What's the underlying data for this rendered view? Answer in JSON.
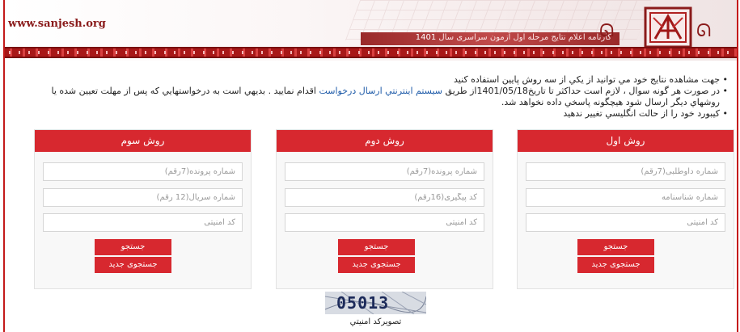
{
  "header": {
    "site_url": "www.sanjesh.org",
    "title_prefix": "کارنامه اعلام نتايج مرحله اول آزمون سراسری سال",
    "title_year": "1401"
  },
  "instructions": {
    "line1": "جهت مشاهده نتايج خود مي توانيد از يكي از سه روش پايين استفاده كنيد",
    "line2_start": "در صورت هر گونه سوال ، لازم است حداكثر تا تاريخ1401/05/18از طريق ",
    "line2_link": "سيستم اينترنتي ارسال درخواست",
    "line2_end": " اقدام نماييد . بديهي است به درخواستهايي كه پس از مهلت تعيين شده يا روشهاي ديگر ارسال شود هيچگونه پاسخي داده نخواهد شد.",
    "line3": "كيبورد خود را از حالت انگليسي تغيير ندهيد"
  },
  "method1": {
    "title": "روش اول",
    "field1_placeholder": "شماره داوطلبی(7رقم)",
    "field2_placeholder": "شماره شناسنامه",
    "field3_placeholder": "کد امنیتی",
    "search_label": "جستجو",
    "new_search_label": "جستجوی جدید"
  },
  "method2": {
    "title": "روش دوم",
    "field1_placeholder": "شماره پرونده(7رقم)",
    "field2_placeholder": "کد پیگیری(16رقم)",
    "field3_placeholder": "کد امنیتی",
    "search_label": "جستجو",
    "new_search_label": "جستجوی جدید"
  },
  "method3": {
    "title": "روش سوم",
    "field1_placeholder": "شماره پرونده(7رقم)",
    "field2_placeholder": "شماره سریال(12 رقم)",
    "field3_placeholder": "کد امنیتی",
    "search_label": "جستجو",
    "new_search_label": "جستجوی جدید"
  },
  "captcha": {
    "code": "05013",
    "label": "تصويركد امنيتي"
  },
  "colors": {
    "accent_red": "#d7282f",
    "header_red": "#8a1b1b",
    "link_blue": "#1d5aa8"
  }
}
